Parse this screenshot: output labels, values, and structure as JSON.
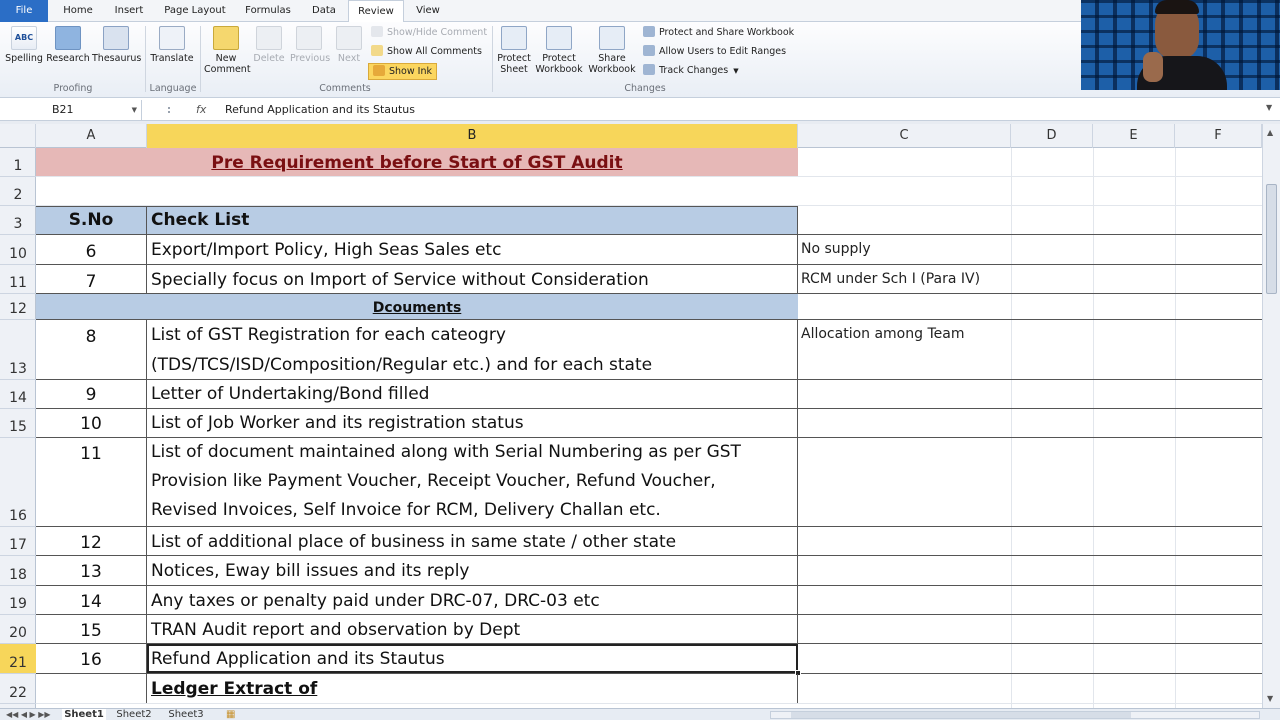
{
  "ribbon_tabs": [
    "File",
    "Home",
    "Insert",
    "Page Layout",
    "Formulas",
    "Data",
    "Review",
    "View"
  ],
  "ribbon": {
    "spelling": "Spelling",
    "research": "Research",
    "thesaurus": "Thesaurus",
    "proofing_group": "Proofing",
    "translate": "Translate",
    "language_group": "Language",
    "new_comment_1": "New",
    "new_comment_2": "Comment",
    "delete": "Delete",
    "previous": "Previous",
    "next": "Next",
    "show_hide_comment": "Show/Hide Comment",
    "show_all_comments": "Show All Comments",
    "show_ink": "Show Ink",
    "comments_group": "Comments",
    "protect_sheet_1": "Protect",
    "protect_sheet_2": "Sheet",
    "protect_workbook_1": "Protect",
    "protect_workbook_2": "Workbook",
    "share_workbook_1": "Share",
    "share_workbook_2": "Workbook",
    "protect_share": "Protect and Share Workbook",
    "allow_users": "Allow Users to Edit Ranges",
    "track_changes": "Track Changes",
    "changes_group": "Changes"
  },
  "formula_bar": {
    "name_box": "B21",
    "fx": "fx",
    "formula": "Refund Application and its Stautus"
  },
  "columns": [
    "A",
    "B",
    "C",
    "D",
    "E",
    "F"
  ],
  "rows": [
    {
      "num": "1",
      "a": "",
      "b": "Pre Requirement before Start of GST Audit",
      "c": ""
    },
    {
      "num": "2",
      "a": "",
      "b": "",
      "c": ""
    },
    {
      "num": "3",
      "a": "S.No",
      "b": "Check List",
      "c": ""
    },
    {
      "num": "10",
      "a": "6",
      "b": "Export/Import Policy, High Seas Sales etc",
      "c": "No supply"
    },
    {
      "num": "11",
      "a": "7",
      "b": "Specially focus on Import of Service without Consideration",
      "c": "RCM under Sch I (Para IV)"
    },
    {
      "num": "12",
      "a": "",
      "b": "Dcouments",
      "c": ""
    },
    {
      "num": "13",
      "a": "8",
      "b": "List of GST Registration for each cateogry (TDS/TCS/ISD/Composition/Regular etc.) and for each state",
      "c": "Allocation among Team"
    },
    {
      "num": "14",
      "a": "9",
      "b": "Letter of Undertaking/Bond filled",
      "c": ""
    },
    {
      "num": "15",
      "a": "10",
      "b": "List of Job Worker and its registration status",
      "c": ""
    },
    {
      "num": "16",
      "a": "11",
      "b": "List of document maintained along with Serial Numbering as per GST Provision like Payment Voucher, Receipt Voucher, Refund Voucher, Revised Invoices, Self Invoice for RCM, Delivery Challan etc.",
      "c": ""
    },
    {
      "num": "17",
      "a": "12",
      "b": "List of additional place of business in same state / other state",
      "c": ""
    },
    {
      "num": "18",
      "a": "13",
      "b": "Notices,  Eway bill issues and its reply",
      "c": ""
    },
    {
      "num": "19",
      "a": "14",
      "b": "Any taxes or penalty paid under DRC-07, DRC-03 etc",
      "c": ""
    },
    {
      "num": "20",
      "a": "15",
      "b": "TRAN Audit report and observation by Dept",
      "c": ""
    },
    {
      "num": "21",
      "a": "16",
      "b": "Refund Application and its Stautus",
      "c": ""
    },
    {
      "num": "22",
      "a": "",
      "b": "Ledger Extract of",
      "c": ""
    }
  ],
  "sheets": [
    "Sheet1",
    "Sheet2",
    "Sheet3"
  ],
  "colors": {
    "title_fill": "#e6b8b7",
    "header_fill": "#b8cce4",
    "selected_header": "#f7d65a",
    "accent": "#2b6ec6"
  }
}
